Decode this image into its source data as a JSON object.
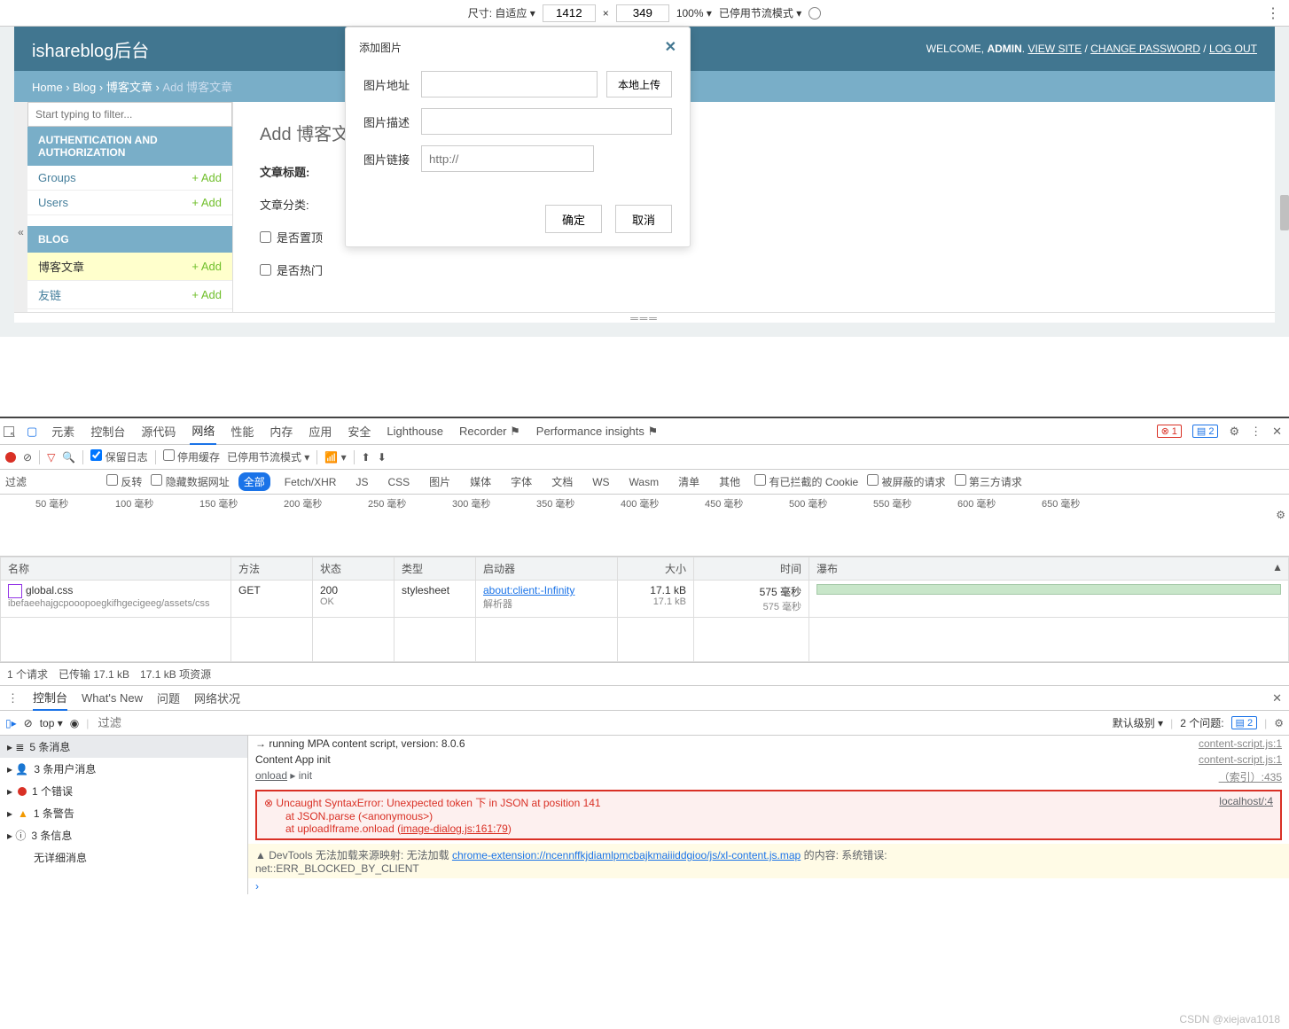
{
  "device_toolbar": {
    "size_label": "尺寸: 自适应 ▾",
    "width": "1412",
    "x": "×",
    "height": "349",
    "zoom": "100% ▾",
    "throttle": "已停用节流模式 ▾"
  },
  "admin": {
    "title": "ishareblog后台",
    "welcome": "WELCOME, ",
    "user": "ADMIN",
    "links": {
      "view_site": "VIEW SITE",
      "change_password": "CHANGE PASSWORD",
      "logout": "LOG OUT"
    },
    "breadcrumb": {
      "home": "Home",
      "blog": "Blog",
      "posts": "博客文章",
      "current": "Add 博客文章"
    },
    "sidebar": {
      "filter_placeholder": "Start typing to filter...",
      "auth_header": "AUTHENTICATION AND AUTHORIZATION",
      "groups": "Groups",
      "users": "Users",
      "blog_header": "BLOG",
      "blog_posts": "博客文章",
      "friendlinks": "友链",
      "add": "+ Add",
      "collapse": "«"
    },
    "page_heading": "Add 博客文章",
    "form": {
      "title": "文章标题:",
      "category": "文章分类:",
      "is_top": "是否置顶",
      "is_hot": "是否热门"
    }
  },
  "modal": {
    "title": "添加图片",
    "img_url": "图片地址",
    "upload_btn": "本地上传",
    "img_desc": "图片描述",
    "img_link": "图片链接",
    "link_placeholder": "http://",
    "ok": "确定",
    "cancel": "取消",
    "close": "✕"
  },
  "devtools": {
    "tabs": {
      "elements": "元素",
      "console": "控制台",
      "sources": "源代码",
      "network": "网络",
      "performance": "性能",
      "memory": "内存",
      "application": "应用",
      "security": "安全",
      "lighthouse": "Lighthouse",
      "recorder": "Recorder ⚑",
      "perf_insights": "Performance insights ⚑"
    },
    "error_count": "1",
    "info_count": "2",
    "subbar": {
      "preserve": "保留日志",
      "disable_cache": "停用缓存",
      "throttling": "已停用节流模式 ▾"
    },
    "filterbar": {
      "filter_label": "过滤",
      "invert": "反转",
      "hide_data": "隐藏数据网址",
      "all": "全部",
      "fetch": "Fetch/XHR",
      "js": "JS",
      "css": "CSS",
      "img": "图片",
      "media": "媒体",
      "font": "字体",
      "doc": "文档",
      "ws": "WS",
      "wasm": "Wasm",
      "manifest": "清单",
      "other": "其他",
      "blocked_cookies": "有已拦截的 Cookie",
      "blocked_req": "被屏蔽的请求",
      "third_party": "第三方请求"
    },
    "timeline_ticks": [
      "50 毫秒",
      "100 毫秒",
      "150 毫秒",
      "200 毫秒",
      "250 毫秒",
      "300 毫秒",
      "350 毫秒",
      "400 毫秒",
      "450 毫秒",
      "500 毫秒",
      "550 毫秒",
      "600 毫秒",
      "650 毫秒"
    ],
    "table": {
      "headers": {
        "name": "名称",
        "method": "方法",
        "status": "状态",
        "type": "类型",
        "initiator": "启动器",
        "size": "大小",
        "time": "时间",
        "waterfall": "瀑布"
      },
      "row": {
        "name": "global.css",
        "name_sub": "ibefaeehajgcpooopoegkifhgecigeeg/assets/css",
        "method": "GET",
        "status": "200",
        "status_sub": "OK",
        "type": "stylesheet",
        "initiator": "about:client:-Infinity",
        "initiator_sub": "解析器",
        "size": "17.1 kB",
        "size_sub": "17.1 kB",
        "time": "575 毫秒",
        "time_sub": "575 毫秒"
      }
    },
    "status_bar": "1 个请求　已传输 17.1 kB　17.1 kB 项资源"
  },
  "console": {
    "tabs": {
      "console": "控制台",
      "whatsnew": "What's New",
      "issues": "问题",
      "network_cond": "网络状况"
    },
    "toolbar": {
      "top": "top ▾",
      "filter_placeholder": "过滤",
      "level": "默认级别 ▾",
      "issues": "2 个问题:"
    },
    "sidebar": {
      "msgs": "5 条消息",
      "user_msgs": "3 条用户消息",
      "errors": "1 个错误",
      "warnings": "1 条警告",
      "info": "3 条信息",
      "no_detail": "无详细消息"
    },
    "messages": {
      "m1": {
        "text": "→ running MPA content script, version: 8.0.6",
        "link": "content-script.js:1"
      },
      "m2": {
        "text": "Content App init",
        "link": "content-script.js:1"
      },
      "m3": {
        "prefix": "onload",
        "text": "▸ init",
        "link": "（索引）:435"
      },
      "error": {
        "line1": "Uncaught SyntaxError: Unexpected token 下 in JSON at position 141",
        "line2": "at JSON.parse (<anonymous>)",
        "line3_pre": "at uploadIframe.onload (",
        "line3_link": "image-dialog.js:161:79",
        "line3_post": ")",
        "link": "localhost/:4"
      },
      "warn": {
        "pre": "DevTools 无法加载来源映射: 无法加载 ",
        "link": "chrome-extension://ncennffkjdiamlpmcbajkmaiiiddgioo/js/xl-content.js.map",
        "post": " 的内容: 系统错误:",
        "line2": "net::ERR_BLOCKED_BY_CLIENT"
      }
    }
  },
  "watermark": "CSDN @xiejava1018"
}
